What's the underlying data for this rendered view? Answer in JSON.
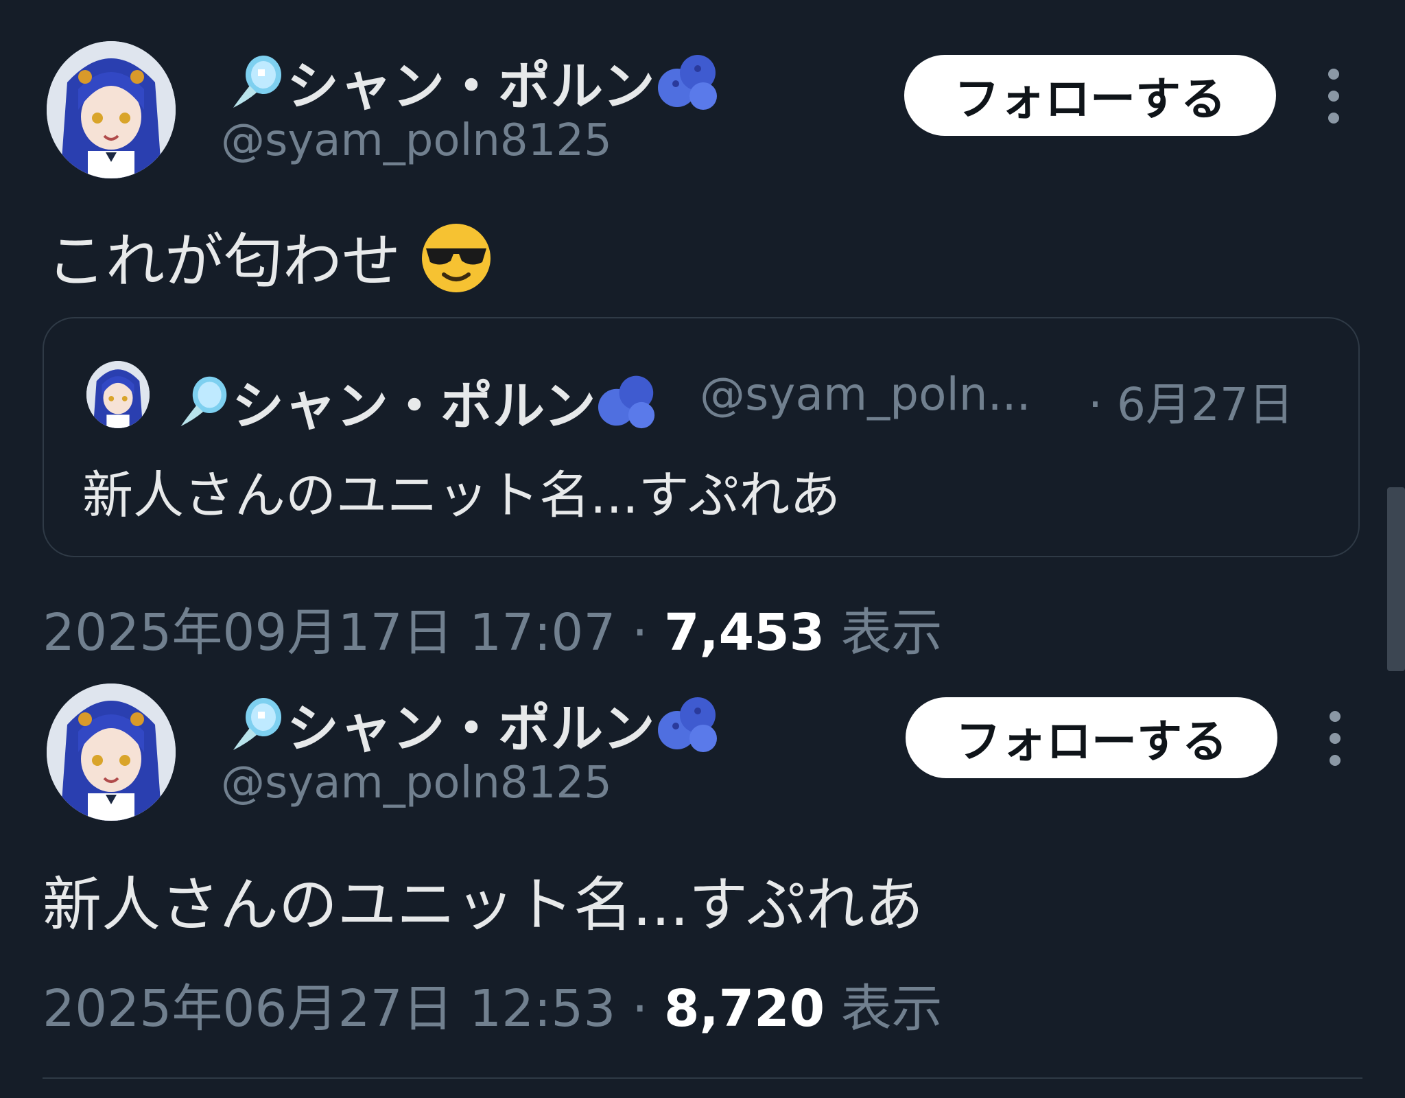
{
  "posts": [
    {
      "author": {
        "name": "シャン・ポルン",
        "handle": "@syam_poln8125",
        "avatar": "anime-avatar"
      },
      "follow_label": "フォローする",
      "text": "これが匂わせ",
      "text_emoji": "smiling-face-with-sunglasses",
      "quote": {
        "name": "シャン・ポルン",
        "handle": "@syam_poln...",
        "date": "· 6月27日",
        "text": "新人さんのユニット名...すぷれあ"
      },
      "timestamp": "2025年09月17日 17:07",
      "separator": "·",
      "views": "7,453",
      "views_label": "表示"
    },
    {
      "author": {
        "name": "シャン・ポルン",
        "handle": "@syam_poln8125",
        "avatar": "anime-avatar"
      },
      "follow_label": "フォローする",
      "text": "新人さんのユニット名...すぷれあ",
      "timestamp": "2025年06月27日 12:53",
      "separator": "·",
      "views": "8,720",
      "views_label": "表示"
    }
  ],
  "colors": {
    "background": "#151d28",
    "text": "#e7e9ea",
    "muted": "#71808f",
    "border": "#2f3a46",
    "button_bg": "#ffffff",
    "blueberry": "#4f6fe0"
  }
}
